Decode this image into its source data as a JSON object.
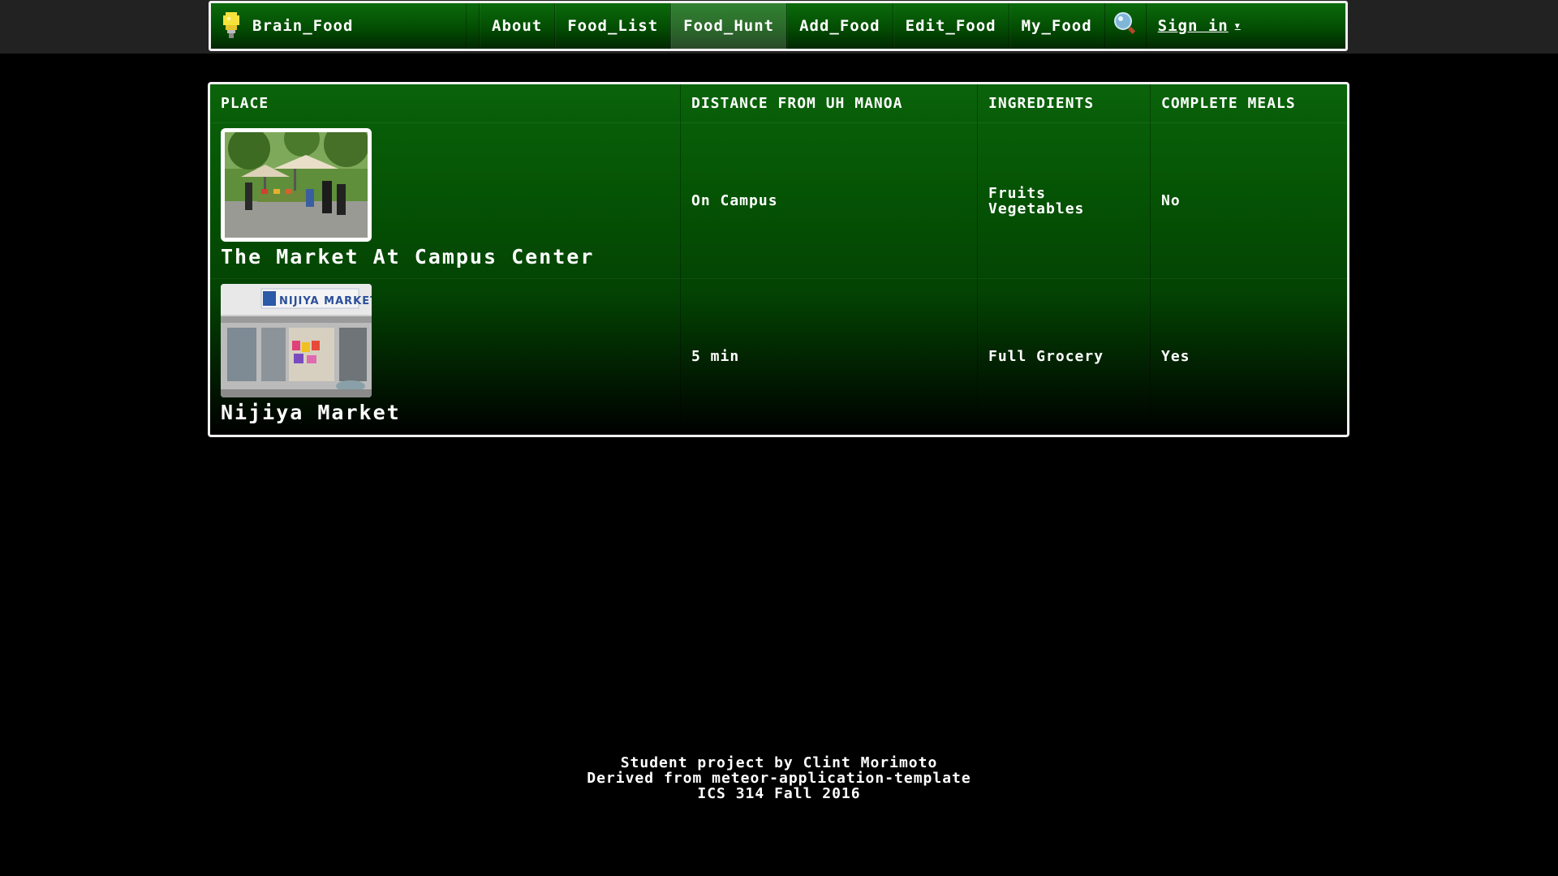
{
  "navbar": {
    "brand": "Brain_Food",
    "items": [
      {
        "label": "About",
        "active": false
      },
      {
        "label": "Food_List",
        "active": false
      },
      {
        "label": "Food_Hunt",
        "active": true
      },
      {
        "label": "Add_Food",
        "active": false
      },
      {
        "label": "Edit_Food",
        "active": false
      },
      {
        "label": "My_Food",
        "active": false
      }
    ],
    "search_icon": "magnifier-icon",
    "signin": "Sign in"
  },
  "table": {
    "headers": [
      "PLACE",
      "DISTANCE FROM UH MANOA",
      "INGREDIENTS",
      "COMPLETE MEALS"
    ],
    "rows": [
      {
        "place": "The Market At Campus Center",
        "image": "farmers-market-photo",
        "distance": "On Campus",
        "ingredients": [
          "Fruits",
          "Vegetables"
        ],
        "complete_meals": "No"
      },
      {
        "place": "Nijiya Market",
        "image": "nijiya-market-storefront-photo",
        "image_sign": "NIJIYA MARKET",
        "distance": "5 min",
        "ingredients": [
          "Full Grocery"
        ],
        "complete_meals": "Yes"
      }
    ]
  },
  "footer": {
    "line1": "Student project by Clint Morimoto",
    "line2": "Derived from meteor-application-template",
    "line3": "ICS 314 Fall 2016"
  },
  "colors": {
    "accent_green": "#0b6b0b",
    "background": "#000000",
    "border": "#f0f0f0"
  }
}
